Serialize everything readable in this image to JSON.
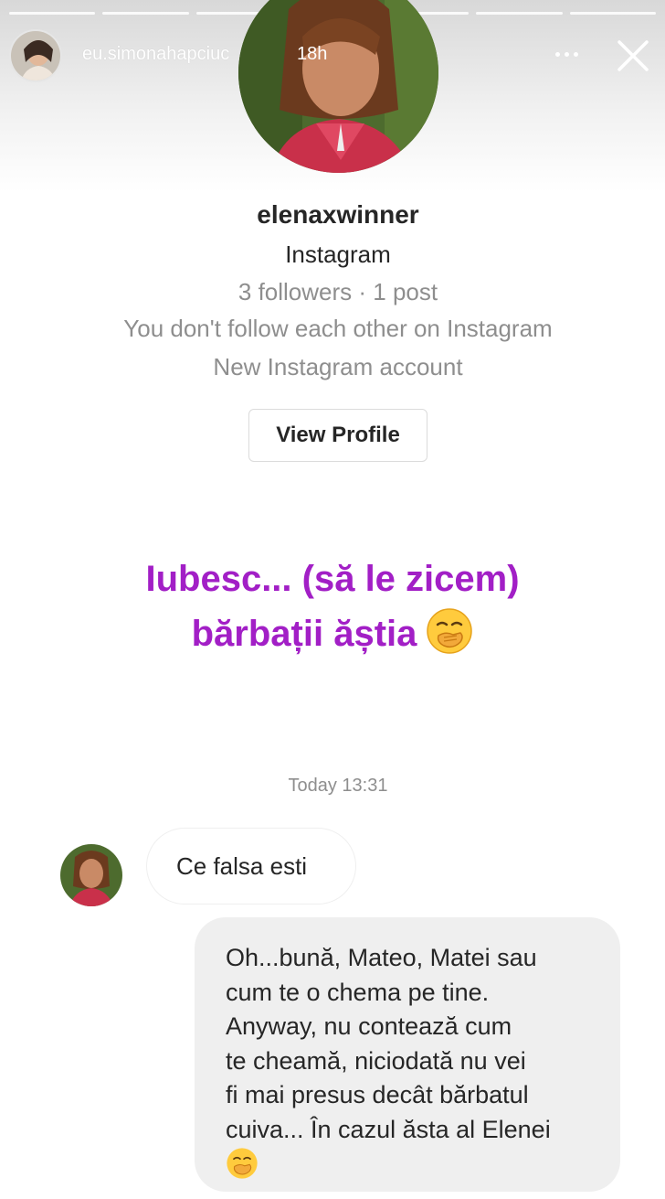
{
  "story": {
    "username": "eu.simonahapciuc",
    "time_ago": "18h",
    "segments": 7
  },
  "profile": {
    "handle": "elenaxwinner",
    "platform": "Instagram",
    "stats": "3 followers · 1 post",
    "follow_status": "You don't follow each other on Instagram",
    "account_note": "New Instagram account",
    "view_profile_label": "View Profile"
  },
  "caption": {
    "line1": "Iubesc... (să le zicem)",
    "line2": "bărbații ăștia",
    "emoji": "face-with-hand-over-mouth",
    "color": "#a21fc6"
  },
  "chat": {
    "timestamp": "Today 13:31",
    "incoming_message": "Ce falsa esti",
    "outgoing_lines": [
      "Oh...bună, Mateo, Matei sau",
      "cum te o chema pe tine.",
      "Anyway, nu contează cum",
      "te cheamă, niciodată nu vei",
      "fi mai presus decât bărbatul",
      "cuiva... În cazul ăsta al Elenei"
    ],
    "outgoing_emoji": "face-with-hand-over-mouth"
  },
  "colors": {
    "secondary_text": "#8e8e8e",
    "primary_text": "#262626",
    "outgoing_bubble": "#efefef"
  }
}
